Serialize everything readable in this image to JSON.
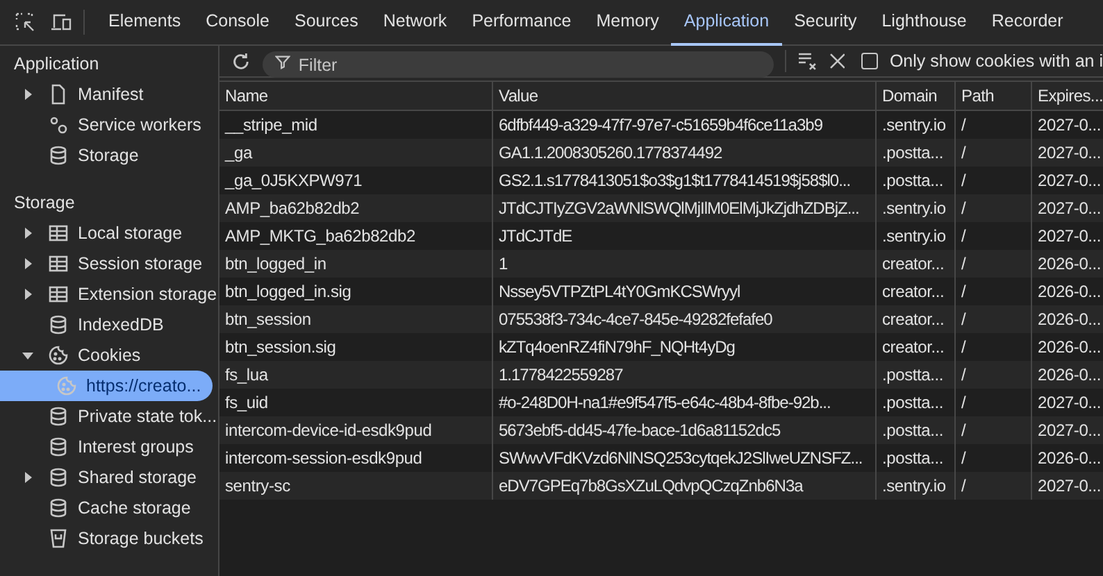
{
  "tabs": [
    {
      "label": "Elements",
      "selected": false
    },
    {
      "label": "Console",
      "selected": false
    },
    {
      "label": "Sources",
      "selected": false
    },
    {
      "label": "Network",
      "selected": false
    },
    {
      "label": "Performance",
      "selected": false
    },
    {
      "label": "Memory",
      "selected": false
    },
    {
      "label": "Application",
      "selected": true
    },
    {
      "label": "Security",
      "selected": false
    },
    {
      "label": "Lighthouse",
      "selected": false
    },
    {
      "label": "Recorder",
      "selected": false
    }
  ],
  "sidebar": {
    "sections": [
      {
        "title": "Application",
        "items": [
          {
            "label": "Manifest",
            "kind": "file",
            "expandable": true,
            "expanded": false
          },
          {
            "label": "Service workers",
            "kind": "gears",
            "expandable": false
          },
          {
            "label": "Storage",
            "kind": "database",
            "expandable": false
          }
        ]
      },
      {
        "title": "Storage",
        "items": [
          {
            "label": "Local storage",
            "kind": "table",
            "expandable": true,
            "expanded": false
          },
          {
            "label": "Session storage",
            "kind": "table",
            "expandable": true,
            "expanded": false
          },
          {
            "label": "Extension storage",
            "kind": "table",
            "expandable": true,
            "expanded": false
          },
          {
            "label": "IndexedDB",
            "kind": "database",
            "expandable": false
          },
          {
            "label": "Cookies",
            "kind": "cookie",
            "expandable": true,
            "expanded": true,
            "children": [
              {
                "label": "https://creato...",
                "kind": "cookie",
                "selected": true
              }
            ]
          },
          {
            "label": "Private state tok...",
            "kind": "database",
            "expandable": false
          },
          {
            "label": "Interest groups",
            "kind": "database",
            "expandable": false
          },
          {
            "label": "Shared storage",
            "kind": "database",
            "expandable": true,
            "expanded": false
          },
          {
            "label": "Cache storage",
            "kind": "database",
            "expandable": false
          },
          {
            "label": "Storage buckets",
            "kind": "bucket",
            "expandable": false
          }
        ]
      }
    ]
  },
  "toolbar": {
    "filter": {
      "placeholder": "Filter"
    },
    "only_issues": {
      "label": "Only show cookies with an i",
      "checked": false
    }
  },
  "table": {
    "columns": [
      "Name",
      "Value",
      "Domain",
      "Path",
      "Expires..."
    ],
    "rows": [
      [
        "__stripe_mid",
        "6dfbf449-a329-47f7-97e7-c51659b4f6ce11a3b9",
        ".sentry.io",
        "/",
        "2027-0..."
      ],
      [
        "_ga",
        "GA1.1.2008305260.1778374492",
        ".postta...",
        "/",
        "2027-0..."
      ],
      [
        "_ga_0J5KXPW971",
        "GS2.1.s1778413051$o3$g1$t1778414519$j58$l0...",
        ".postta...",
        "/",
        "2027-0..."
      ],
      [
        "AMP_ba62b82db2",
        "JTdCJTIyZGV2aWNlSWQlMjIlM0ElMjJkZjdhZDBjZ...",
        ".sentry.io",
        "/",
        "2027-0..."
      ],
      [
        "AMP_MKTG_ba62b82db2",
        "JTdCJTdE",
        ".sentry.io",
        "/",
        "2027-0..."
      ],
      [
        "btn_logged_in",
        "1",
        "creator...",
        "/",
        "2026-0..."
      ],
      [
        "btn_logged_in.sig",
        "Nssey5VTPZtPL4tY0GmKCSWryyl",
        "creator...",
        "/",
        "2026-0..."
      ],
      [
        "btn_session",
        "075538f3-734c-4ce7-845e-49282fefafe0",
        "creator...",
        "/",
        "2026-0..."
      ],
      [
        "btn_session.sig",
        "kZTq4oenRZ4fiN79hF_NQHt4yDg",
        "creator...",
        "/",
        "2026-0..."
      ],
      [
        "fs_lua",
        "1.1778422559287",
        ".postta...",
        "/",
        "2026-0..."
      ],
      [
        "fs_uid",
        "#o-248D0H-na1#e9f547f5-e64c-48b4-8fbe-92b...",
        ".postta...",
        "/",
        "2027-0..."
      ],
      [
        "intercom-device-id-esdk9pud",
        "5673ebf5-dd45-47fe-bace-1d6a81152dc5",
        ".postta...",
        "/",
        "2027-0..."
      ],
      [
        "intercom-session-esdk9pud",
        "SWwvVFdKVzd6NlNSQ253cytqekJ2SlIweUZNSFZ...",
        ".postta...",
        "/",
        "2026-0..."
      ],
      [
        "sentry-sc",
        "eDV7GPEq7b8GsXZuLQdvpQCzqZnb6N3a",
        ".sentry.io",
        "/",
        "2027-0..."
      ]
    ]
  }
}
